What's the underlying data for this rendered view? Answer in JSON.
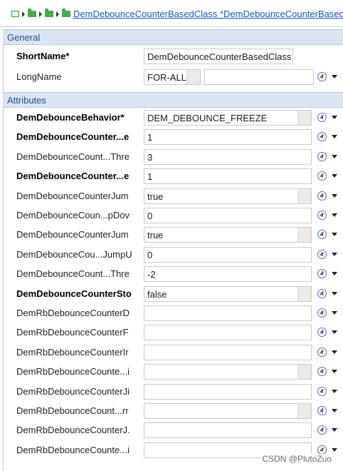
{
  "breadcrumb": {
    "title": "DemDebounceCounterBasedClass *DemDebounceCounterBased"
  },
  "general": {
    "header": "General",
    "short_name": {
      "label": "ShortName*",
      "value": "DemDebounceCounterBasedClass"
    },
    "long_name": {
      "label": "LongName",
      "language": "FOR-ALL",
      "value": ""
    }
  },
  "attributes": {
    "header": "Attributes",
    "rows": [
      {
        "label": "DemDebounceBehavior*",
        "value": "DEM_DEBOUNCE_FREEZE",
        "bold": true,
        "combo": true
      },
      {
        "label": "DemDebounceCounter...e",
        "value": "1",
        "bold": true,
        "combo": false
      },
      {
        "label": "DemDebounceCount...Thre",
        "value": "3",
        "bold": false,
        "combo": false
      },
      {
        "label": "DemDebounceCounter...e",
        "value": "1",
        "bold": true,
        "combo": false
      },
      {
        "label": "DemDebounceCounterJum",
        "value": "true",
        "bold": false,
        "combo": true
      },
      {
        "label": "DemDebounceCoun...pDov",
        "value": "0",
        "bold": false,
        "combo": false
      },
      {
        "label": "DemDebounceCounterJum",
        "value": "true",
        "bold": false,
        "combo": true
      },
      {
        "label": "DemDebounceCou...JumpU",
        "value": "0",
        "bold": false,
        "combo": false
      },
      {
        "label": "DemDebounceCount...Thre",
        "value": "-2",
        "bold": false,
        "combo": false
      },
      {
        "label": "DemDebounceCounterSto",
        "value": "false",
        "bold": true,
        "combo": true
      },
      {
        "label": "DemRbDebounceCounterD",
        "value": "",
        "bold": false,
        "combo": false
      },
      {
        "label": "DemRbDebounceCounterF",
        "value": "",
        "bold": false,
        "combo": false
      },
      {
        "label": "DemRbDebounceCounterIr",
        "value": "",
        "bold": false,
        "combo": false
      },
      {
        "label": "DemRbDebounceCounte...i",
        "value": "",
        "bold": false,
        "combo": true
      },
      {
        "label": "DemRbDebounceCounterJi",
        "value": "",
        "bold": false,
        "combo": false
      },
      {
        "label": "DemRbDebounceCount...rr",
        "value": "",
        "bold": false,
        "combo": true
      },
      {
        "label": "DemRbDebounceCounterJ.",
        "value": "",
        "bold": false,
        "combo": false
      },
      {
        "label": "DemRbDebounceCounte...i",
        "value": "",
        "bold": false,
        "combo": false
      }
    ]
  },
  "icons": {
    "reset": "reset-default-icon",
    "menu": "chevron-down-icon",
    "breadcrumb_page": "page-icon",
    "breadcrumb_folder": "folder-icon"
  },
  "colors": {
    "section_header_bg": "#dbe5f1",
    "section_header_text": "#1f4e8c",
    "link": "#1b56c6"
  },
  "watermark": "CSDN @PlutoZuo"
}
